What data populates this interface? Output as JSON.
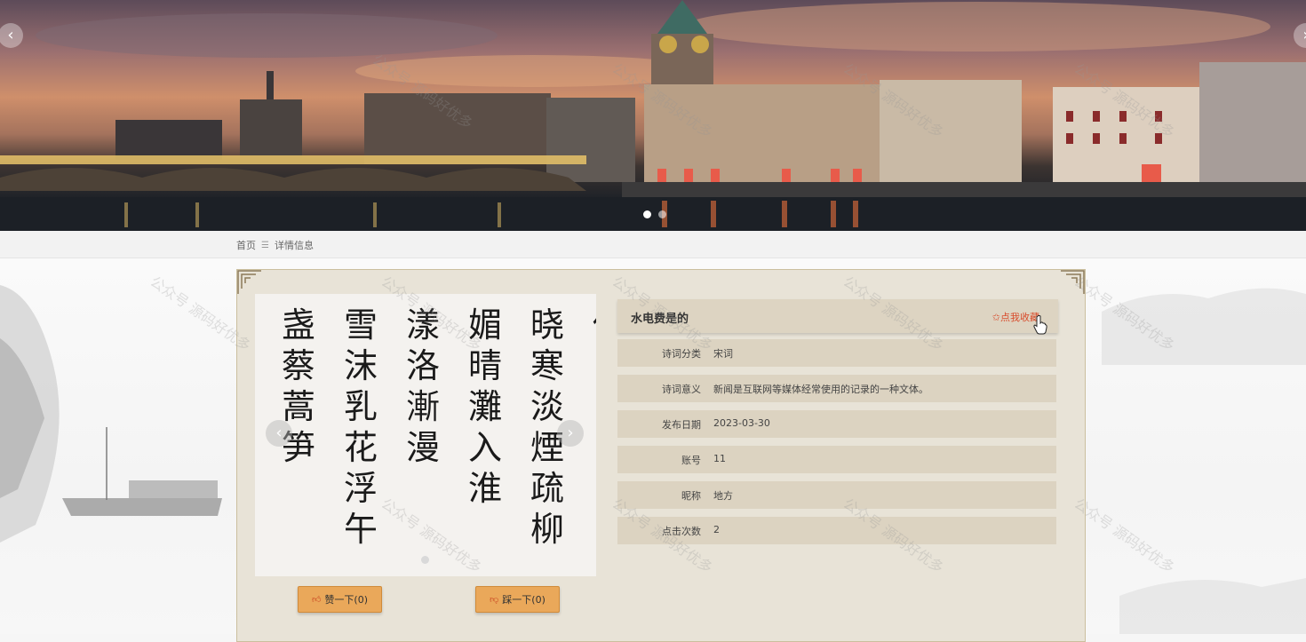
{
  "banner": {
    "prev_icon": "chevron-left-icon",
    "next_icon": "chevron-right-icon",
    "prev_glyph": "‹",
    "next_glyph": "›",
    "slide_count": 2,
    "active_slide": 1
  },
  "breadcrumb": {
    "home": "首页",
    "separator": "☰",
    "current": "详情信息"
  },
  "detail": {
    "title": "水电费是的",
    "favorite_label": "✩点我收藏",
    "fields": [
      {
        "label": "诗词分类",
        "value": "宋词"
      },
      {
        "label": "诗词意义",
        "value": "新闻是互联网等媒体经常使用的记录的一种文体。"
      },
      {
        "label": "发布日期",
        "value": "2023-03-30"
      },
      {
        "label": "账号",
        "value": "11"
      },
      {
        "label": "昵称",
        "value": "地方"
      },
      {
        "label": "点击次数",
        "value": "2"
      }
    ],
    "like_button": "赞一下(0)",
    "dislike_button": "踩一下(0)"
  },
  "gallery": {
    "prev_glyph": "‹",
    "next_glyph": "›",
    "calligraphy_columns": [
      "盏蔡蒿笋",
      "雪沫乳花浮午",
      "漾洛漸漫",
      "媚晴灘入淮",
      "晓寒淡煙疏柳",
      "佃"
    ]
  },
  "watermark": "公众号 源码好优多",
  "colors": {
    "accent": "#d84b2b",
    "panel": "#e8e3d7",
    "row": "#dcd3c1",
    "button": "#eaa85a"
  }
}
